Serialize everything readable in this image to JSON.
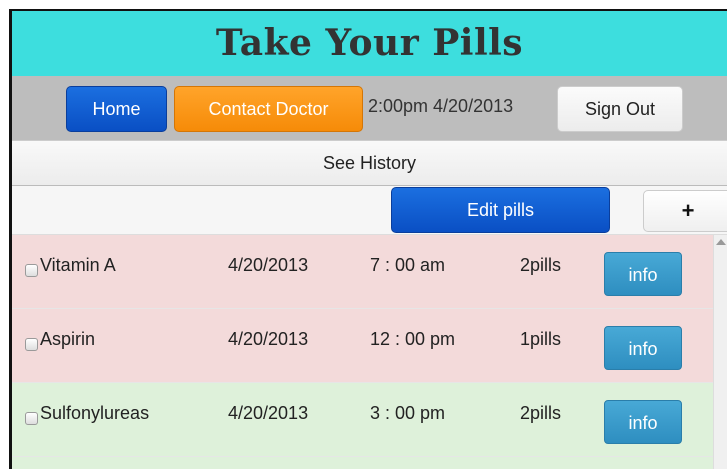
{
  "header": {
    "title": "Take Your Pills"
  },
  "nav": {
    "home_label": "Home",
    "contact_label": "Contact Doctor",
    "datetime": "2:00pm 4/20/2013",
    "signout_label": "Sign Out",
    "home_color": "#0a56cf",
    "contact_color": "#fb9512",
    "header_color": "#3ddede"
  },
  "history": {
    "label": "See History"
  },
  "toolbar": {
    "edit_label": "Edit pills",
    "add_label": "+"
  },
  "pills": [
    {
      "name": "Vitamin A",
      "date": "4/20/2013",
      "time": "7 : 00 am",
      "qty": "2pills",
      "info_label": "info",
      "status": "overdue",
      "checked": false
    },
    {
      "name": "Aspirin",
      "date": "4/20/2013",
      "time": "12 : 00 pm",
      "qty": "1pills",
      "info_label": "info",
      "status": "overdue",
      "checked": false
    },
    {
      "name": "Sulfonylureas",
      "date": "4/20/2013",
      "time": "3 : 00 pm",
      "qty": "2pills",
      "info_label": "info",
      "status": "upcoming",
      "checked": false
    }
  ],
  "status_colors": {
    "overdue": "#f3dada",
    "upcoming": "#def1da"
  }
}
